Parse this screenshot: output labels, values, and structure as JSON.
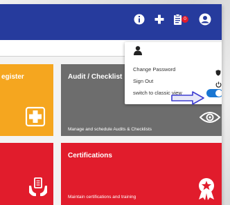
{
  "colors": {
    "header": "#263b9d",
    "tile_orange": "#f5a61f",
    "tile_gray": "#6d6d6d",
    "tile_red": "#e11c2c",
    "toggle_on": "#1976d2",
    "arrow": "#3b3bd1"
  },
  "header": {
    "icons": [
      "info-icon",
      "plus-icon",
      "clipboard-icon",
      "user-circle-icon"
    ],
    "notification_badge": "0"
  },
  "tiles": {
    "register_title": "egister",
    "audit_title": "Audit / Checklist",
    "audit_desc": "Manage and schedule Audits & Checklists",
    "certifications_title": "Certifications",
    "certifications_desc": "Maintain certifications and training"
  },
  "user_menu": {
    "change_password": "Change Password",
    "sign_out": "Sign Out",
    "classic_view": "switch to classic view",
    "classic_view_on": true
  }
}
